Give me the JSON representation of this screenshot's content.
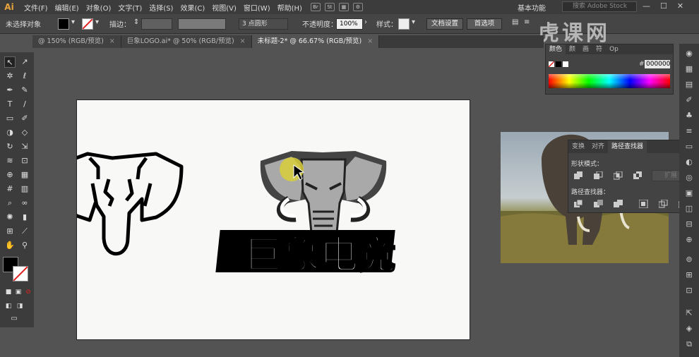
{
  "menu": {
    "app": "Ai",
    "items": [
      "文件(F)",
      "编辑(E)",
      "对象(O)",
      "文字(T)",
      "选择(S)",
      "效果(C)",
      "视图(V)",
      "窗口(W)",
      "帮助(H)"
    ],
    "workspace": "基本功能",
    "search_placeholder": "搜索 Adobe Stock"
  },
  "control": {
    "selection": "未选择对象",
    "stroke_label": "描边：",
    "brush": "3 点圆形",
    "opacity_label": "不透明度：",
    "opacity": "100%",
    "style_label": "样式：",
    "doc_setup": "文档设置",
    "prefs": "首选项"
  },
  "tabs": [
    {
      "label": "@ 150% (RGB/预览)",
      "active": false
    },
    {
      "label": "巨象LOGO.ai* @ 50% (RGB/预览)",
      "active": false
    },
    {
      "label": "未标题-2* @ 66.67% (RGB/预览)",
      "active": true
    }
  ],
  "color_panel": {
    "tabs": [
      "颜色",
      "颜",
      "画",
      "符",
      "Op"
    ],
    "hex_label": "#",
    "hex": "000000"
  },
  "pathfinder": {
    "tabs": [
      "变换",
      "对齐",
      "路径查找器"
    ],
    "shape_modes": "形状模式：",
    "expand": "扩展",
    "pathfinders": "路径查找器："
  },
  "artwork": {
    "logo_text": "巨象电竞"
  },
  "watermark": "虎课网",
  "colors": {
    "accent": "#e8a33a",
    "elephant_gray": "#a9a9a9",
    "highlight": "#d9cf3a"
  }
}
